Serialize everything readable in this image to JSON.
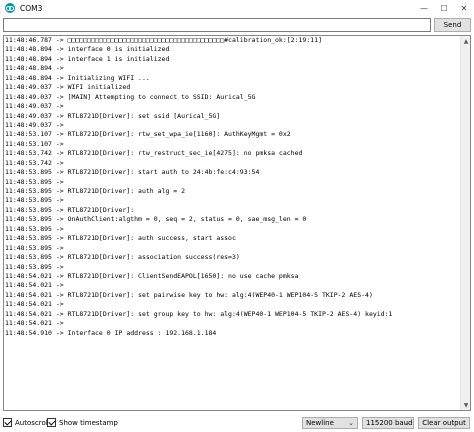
{
  "window": {
    "title": "COM3",
    "minimize_glyph": "—",
    "maximize_glyph": "☐",
    "close_glyph": "✕"
  },
  "send_bar": {
    "input_value": "",
    "send_label": "Send"
  },
  "output": {
    "lines": [
      "11:48:46.787 -> □□□□□□□□□□□□□□□□□□□□□□□□□□□□□□□□□□□□□□□□#calibration_ok:[2:19:11]",
      "11:48:48.894 -> interface 0 is initialized",
      "11:48:48.894 -> interface 1 is initialized",
      "11:48:48.894 ->",
      "11:48:48.894 -> Initializing WIFI ...",
      "11:48:49.037 -> WIFI initialized",
      "11:48:49.037 -> [MAIN] Attempting to connect to SSID: Aurical_5G",
      "11:48:49.037 ->",
      "11:48:49.037 -> RTL8721D[Driver]: set ssid [Aurical_5G]",
      "11:48:49.037 ->",
      "11:48:53.107 -> RTL8721D[Driver]: rtw_set_wpa_ie[1160]: AuthKeyMgmt = 0x2",
      "11:48:53.107 ->",
      "11:48:53.742 -> RTL8721D[Driver]: rtw_restruct_sec_ie[4275]: no pmksa cached",
      "11:48:53.742 ->",
      "11:48:53.895 -> RTL8721D[Driver]: start auth to 24:4b:fe:c4:93:54",
      "11:48:53.895 ->",
      "11:48:53.895 -> RTL8721D[Driver]: auth alg = 2",
      "11:48:53.895 ->",
      "11:48:53.895 -> RTL8721D[Driver]:",
      "11:48:53.895 -> OnAuthClient:algthm = 0, seq = 2, status = 0, sae_msg_len = 0",
      "11:48:53.895 ->",
      "11:48:53.895 -> RTL8721D[Driver]: auth success, start assoc",
      "11:48:53.895 ->",
      "11:48:53.895 -> RTL8721D[Driver]: association success(res=3)",
      "11:48:53.895 ->",
      "11:48:54.021 -> RTL8721D[Driver]: ClientSendEAPOL[1650]: no use cache pmksa",
      "11:48:54.021 ->",
      "11:48:54.021 -> RTL8721D[Driver]: set pairwise key to hw: alg:4(WEP40-1 WEP104-5 TKIP-2 AES-4)",
      "11:48:54.021 ->",
      "11:48:54.021 -> RTL8721D[Driver]: set group key to hw: alg:4(WEP40-1 WEP104-5 TKIP-2 AES-4) keyid:1",
      "11:48:54.021 ->",
      "11:48:54.910 -> Interface 0 IP address : 192.168.1.184"
    ]
  },
  "bottom_bar": {
    "autoscroll_label": "Autoscroll",
    "autoscroll_checked": true,
    "timestamp_label": "Show timestamp",
    "timestamp_checked": true,
    "line_ending": "Newline",
    "baud_rate": "115200 baud",
    "clear_label": "Clear output"
  },
  "colors": {
    "app_icon": "#00979c",
    "button_face": "#e1e1e1",
    "border": "#828790"
  },
  "icons": [
    "arduino-app-icon",
    "minimize-icon",
    "maximize-icon",
    "close-icon",
    "chevron-down-icon",
    "checkmark-icon",
    "scroll-up-icon",
    "scroll-down-icon"
  ]
}
